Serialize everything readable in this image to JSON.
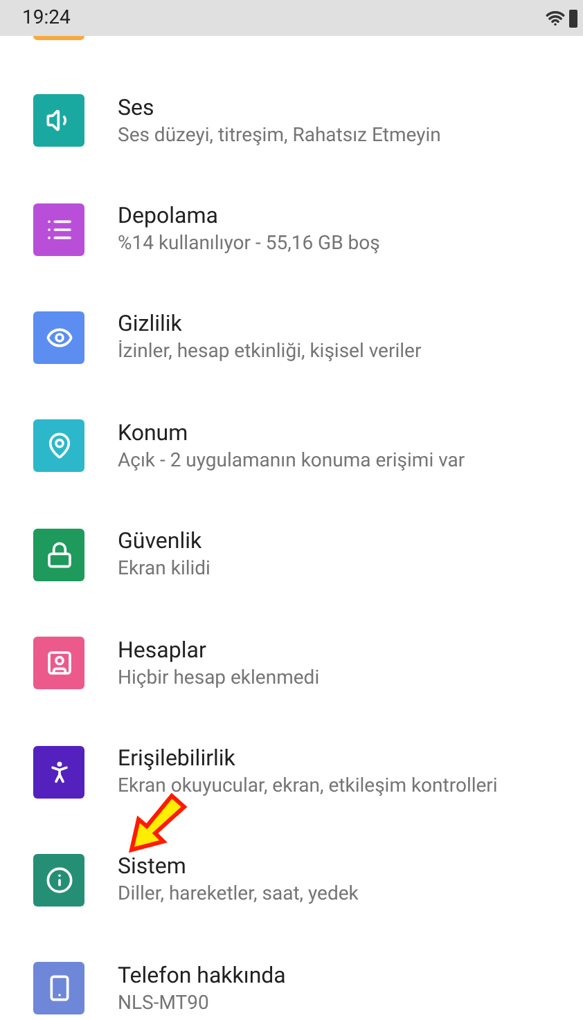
{
  "status_bar": {
    "time": "19:24"
  },
  "items": [
    {
      "title": "Ses",
      "subtitle": "Ses düzeyi, titreşim, Rahatsız Etmeyin",
      "color": "#1aa9a0"
    },
    {
      "title": "Depolama",
      "subtitle": "%14 kullanılıyor - 55,16 GB boş",
      "color": "#b94fd8"
    },
    {
      "title": "Gizlilik",
      "subtitle": "İzinler, hesap etkinliği, kişisel veriler",
      "color": "#5b8ef0"
    },
    {
      "title": "Konum",
      "subtitle": "Açık - 2 uygulamanın konuma erişimi var",
      "color": "#2db7cb"
    },
    {
      "title": "Güvenlik",
      "subtitle": "Ekran kilidi",
      "color": "#1e9a5c"
    },
    {
      "title": "Hesaplar",
      "subtitle": "Hiçbir hesap eklenmedi",
      "color": "#ec5a8b"
    },
    {
      "title": "Erişilebilirlik",
      "subtitle": "Ekran okuyucular, ekran, etkileşim kontrolleri",
      "color": "#5421be"
    },
    {
      "title": "Sistem",
      "subtitle": "Diller, hareketler, saat, yedek",
      "color": "#258f76"
    },
    {
      "title": "Telefon hakkında",
      "subtitle": "NLS-MT90",
      "color": "#6f87d8"
    }
  ]
}
